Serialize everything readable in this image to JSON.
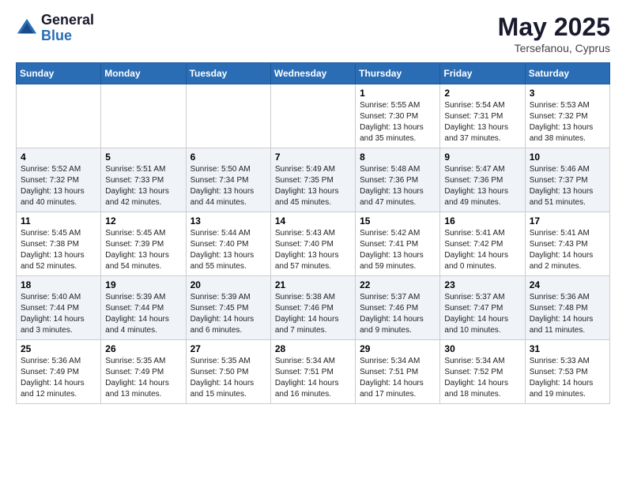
{
  "logo": {
    "general": "General",
    "blue": "Blue"
  },
  "title": {
    "month_year": "May 2025",
    "location": "Tersefanou, Cyprus"
  },
  "weekdays": [
    "Sunday",
    "Monday",
    "Tuesday",
    "Wednesday",
    "Thursday",
    "Friday",
    "Saturday"
  ],
  "weeks": [
    [
      {
        "day": "",
        "sunrise": "",
        "sunset": "",
        "daylight": ""
      },
      {
        "day": "",
        "sunrise": "",
        "sunset": "",
        "daylight": ""
      },
      {
        "day": "",
        "sunrise": "",
        "sunset": "",
        "daylight": ""
      },
      {
        "day": "",
        "sunrise": "",
        "sunset": "",
        "daylight": ""
      },
      {
        "day": "1",
        "sunrise": "Sunrise: 5:55 AM",
        "sunset": "Sunset: 7:30 PM",
        "daylight": "Daylight: 13 hours and 35 minutes."
      },
      {
        "day": "2",
        "sunrise": "Sunrise: 5:54 AM",
        "sunset": "Sunset: 7:31 PM",
        "daylight": "Daylight: 13 hours and 37 minutes."
      },
      {
        "day": "3",
        "sunrise": "Sunrise: 5:53 AM",
        "sunset": "Sunset: 7:32 PM",
        "daylight": "Daylight: 13 hours and 38 minutes."
      }
    ],
    [
      {
        "day": "4",
        "sunrise": "Sunrise: 5:52 AM",
        "sunset": "Sunset: 7:32 PM",
        "daylight": "Daylight: 13 hours and 40 minutes."
      },
      {
        "day": "5",
        "sunrise": "Sunrise: 5:51 AM",
        "sunset": "Sunset: 7:33 PM",
        "daylight": "Daylight: 13 hours and 42 minutes."
      },
      {
        "day": "6",
        "sunrise": "Sunrise: 5:50 AM",
        "sunset": "Sunset: 7:34 PM",
        "daylight": "Daylight: 13 hours and 44 minutes."
      },
      {
        "day": "7",
        "sunrise": "Sunrise: 5:49 AM",
        "sunset": "Sunset: 7:35 PM",
        "daylight": "Daylight: 13 hours and 45 minutes."
      },
      {
        "day": "8",
        "sunrise": "Sunrise: 5:48 AM",
        "sunset": "Sunset: 7:36 PM",
        "daylight": "Daylight: 13 hours and 47 minutes."
      },
      {
        "day": "9",
        "sunrise": "Sunrise: 5:47 AM",
        "sunset": "Sunset: 7:36 PM",
        "daylight": "Daylight: 13 hours and 49 minutes."
      },
      {
        "day": "10",
        "sunrise": "Sunrise: 5:46 AM",
        "sunset": "Sunset: 7:37 PM",
        "daylight": "Daylight: 13 hours and 51 minutes."
      }
    ],
    [
      {
        "day": "11",
        "sunrise": "Sunrise: 5:45 AM",
        "sunset": "Sunset: 7:38 PM",
        "daylight": "Daylight: 13 hours and 52 minutes."
      },
      {
        "day": "12",
        "sunrise": "Sunrise: 5:45 AM",
        "sunset": "Sunset: 7:39 PM",
        "daylight": "Daylight: 13 hours and 54 minutes."
      },
      {
        "day": "13",
        "sunrise": "Sunrise: 5:44 AM",
        "sunset": "Sunset: 7:40 PM",
        "daylight": "Daylight: 13 hours and 55 minutes."
      },
      {
        "day": "14",
        "sunrise": "Sunrise: 5:43 AM",
        "sunset": "Sunset: 7:40 PM",
        "daylight": "Daylight: 13 hours and 57 minutes."
      },
      {
        "day": "15",
        "sunrise": "Sunrise: 5:42 AM",
        "sunset": "Sunset: 7:41 PM",
        "daylight": "Daylight: 13 hours and 59 minutes."
      },
      {
        "day": "16",
        "sunrise": "Sunrise: 5:41 AM",
        "sunset": "Sunset: 7:42 PM",
        "daylight": "Daylight: 14 hours and 0 minutes."
      },
      {
        "day": "17",
        "sunrise": "Sunrise: 5:41 AM",
        "sunset": "Sunset: 7:43 PM",
        "daylight": "Daylight: 14 hours and 2 minutes."
      }
    ],
    [
      {
        "day": "18",
        "sunrise": "Sunrise: 5:40 AM",
        "sunset": "Sunset: 7:44 PM",
        "daylight": "Daylight: 14 hours and 3 minutes."
      },
      {
        "day": "19",
        "sunrise": "Sunrise: 5:39 AM",
        "sunset": "Sunset: 7:44 PM",
        "daylight": "Daylight: 14 hours and 4 minutes."
      },
      {
        "day": "20",
        "sunrise": "Sunrise: 5:39 AM",
        "sunset": "Sunset: 7:45 PM",
        "daylight": "Daylight: 14 hours and 6 minutes."
      },
      {
        "day": "21",
        "sunrise": "Sunrise: 5:38 AM",
        "sunset": "Sunset: 7:46 PM",
        "daylight": "Daylight: 14 hours and 7 minutes."
      },
      {
        "day": "22",
        "sunrise": "Sunrise: 5:37 AM",
        "sunset": "Sunset: 7:46 PM",
        "daylight": "Daylight: 14 hours and 9 minutes."
      },
      {
        "day": "23",
        "sunrise": "Sunrise: 5:37 AM",
        "sunset": "Sunset: 7:47 PM",
        "daylight": "Daylight: 14 hours and 10 minutes."
      },
      {
        "day": "24",
        "sunrise": "Sunrise: 5:36 AM",
        "sunset": "Sunset: 7:48 PM",
        "daylight": "Daylight: 14 hours and 11 minutes."
      }
    ],
    [
      {
        "day": "25",
        "sunrise": "Sunrise: 5:36 AM",
        "sunset": "Sunset: 7:49 PM",
        "daylight": "Daylight: 14 hours and 12 minutes."
      },
      {
        "day": "26",
        "sunrise": "Sunrise: 5:35 AM",
        "sunset": "Sunset: 7:49 PM",
        "daylight": "Daylight: 14 hours and 13 minutes."
      },
      {
        "day": "27",
        "sunrise": "Sunrise: 5:35 AM",
        "sunset": "Sunset: 7:50 PM",
        "daylight": "Daylight: 14 hours and 15 minutes."
      },
      {
        "day": "28",
        "sunrise": "Sunrise: 5:34 AM",
        "sunset": "Sunset: 7:51 PM",
        "daylight": "Daylight: 14 hours and 16 minutes."
      },
      {
        "day": "29",
        "sunrise": "Sunrise: 5:34 AM",
        "sunset": "Sunset: 7:51 PM",
        "daylight": "Daylight: 14 hours and 17 minutes."
      },
      {
        "day": "30",
        "sunrise": "Sunrise: 5:34 AM",
        "sunset": "Sunset: 7:52 PM",
        "daylight": "Daylight: 14 hours and 18 minutes."
      },
      {
        "day": "31",
        "sunrise": "Sunrise: 5:33 AM",
        "sunset": "Sunset: 7:53 PM",
        "daylight": "Daylight: 14 hours and 19 minutes."
      }
    ]
  ]
}
